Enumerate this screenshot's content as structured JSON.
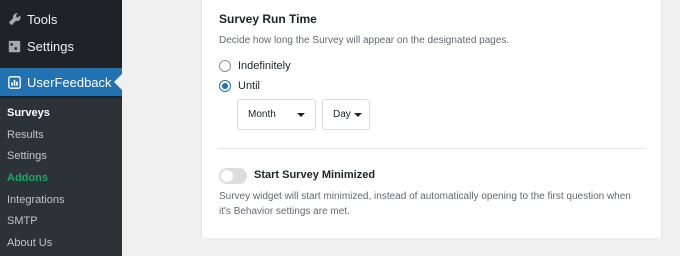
{
  "sidebar": {
    "items": [
      {
        "label": "Tools",
        "icon": "wrench-icon"
      },
      {
        "label": "Settings",
        "icon": "settings-icon"
      },
      {
        "label": "UserFeedback",
        "icon": "userfeedback-icon",
        "active": true
      }
    ],
    "submenu": [
      {
        "label": "Surveys",
        "current": true
      },
      {
        "label": "Results"
      },
      {
        "label": "Settings"
      },
      {
        "label": "Addons",
        "highlight": true
      },
      {
        "label": "Integrations"
      },
      {
        "label": "SMTP"
      },
      {
        "label": "About Us"
      }
    ]
  },
  "run_time": {
    "title": "Survey Run Time",
    "description": "Decide how long the Survey will appear on the designated pages.",
    "options": {
      "indefinitely": "Indefinitely",
      "until": "Until",
      "selected": "until"
    },
    "month_select": "Month",
    "day_select": "Day"
  },
  "minimized": {
    "title": "Start Survey Minimized",
    "enabled": false,
    "description_line1": "Survey widget will start minimized, instead of automatically opening to the first question when",
    "description_line2": "it's Behavior settings are met."
  },
  "colors": {
    "sidebar_bg": "#1d2327",
    "submenu_bg": "#2c3338",
    "accent": "#2271b1",
    "addons_green": "#1da867"
  }
}
